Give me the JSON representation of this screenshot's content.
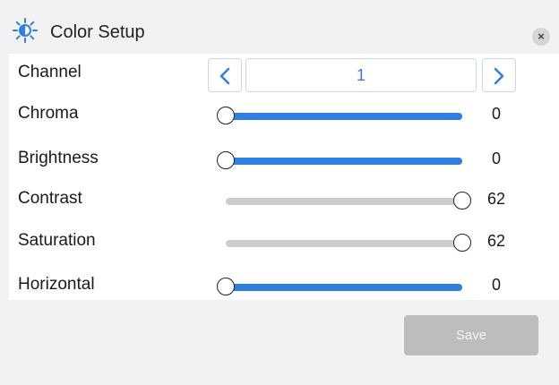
{
  "dialog": {
    "title": "Color Setup",
    "title_icon": "brightness-icon",
    "close_icon": "close-icon",
    "close_glyph": "×"
  },
  "channel": {
    "label": "Channel",
    "value": "1",
    "prev_icon": "chevron-left-icon",
    "next_icon": "chevron-right-icon"
  },
  "sliders": [
    {
      "label": "Chroma",
      "value": "0",
      "max": 62,
      "active": true
    },
    {
      "label": "Brightness",
      "value": "0",
      "max": 62,
      "active": true
    },
    {
      "label": "Contrast",
      "value": "62",
      "max": 62,
      "active": false
    },
    {
      "label": "Saturation",
      "value": "62",
      "max": 62,
      "active": false
    },
    {
      "label": "Horizontal",
      "value": "0",
      "max": 62,
      "active": true
    }
  ],
  "actions": {
    "save_label": "Save"
  },
  "colors": {
    "accent": "#2f7fe0",
    "track_inactive": "#cccccc",
    "save_disabled": "#bdbdbd",
    "icon_blue": "#2f7fe0"
  }
}
